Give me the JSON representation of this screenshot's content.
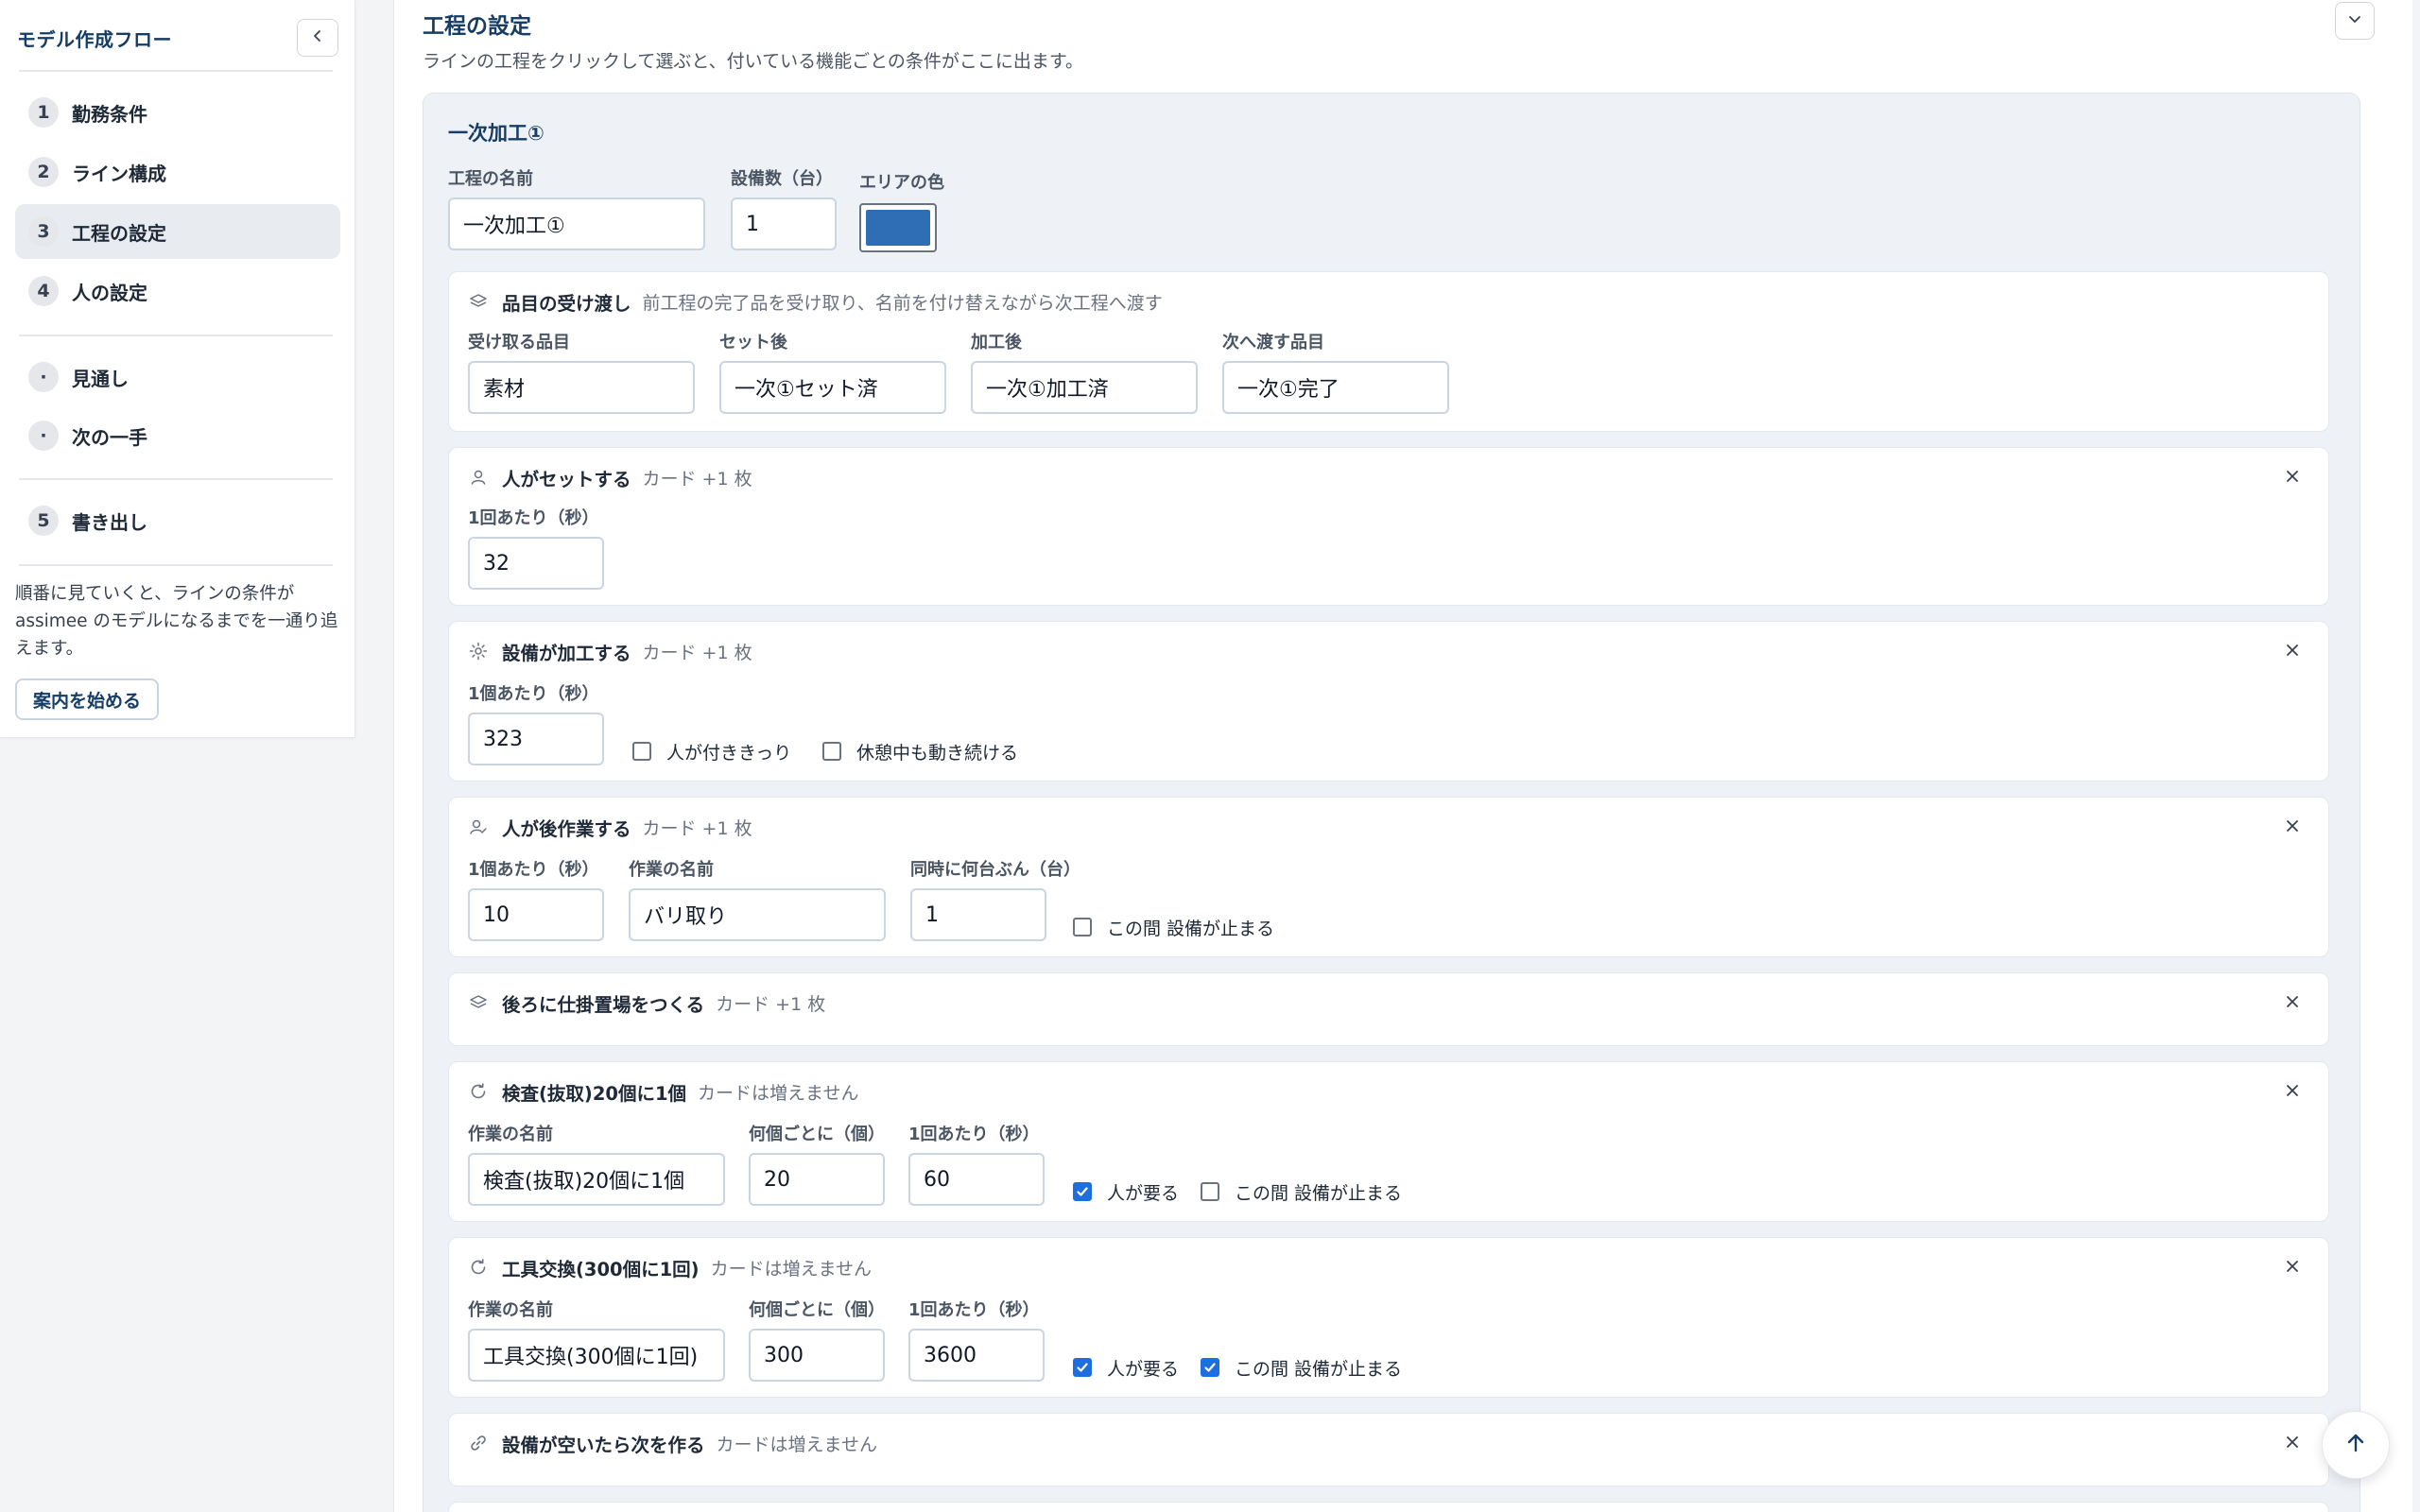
{
  "sidebar": {
    "title": "モデル作成フロー",
    "collapse_icon": "chevron-left-icon",
    "items": [
      {
        "num": "1",
        "label": "勤務条件"
      },
      {
        "num": "2",
        "label": "ライン構成"
      },
      {
        "num": "3",
        "label": "工程の設定"
      },
      {
        "num": "4",
        "label": "人の設定"
      },
      {
        "num": "·",
        "label": "見通し"
      },
      {
        "num": "·",
        "label": "次の一手"
      },
      {
        "num": "5",
        "label": "書き出し"
      }
    ],
    "active_index": 2,
    "help_line1": "順番に見ていくと、ラインの条件が",
    "help_line2": "assimee のモデルになるまでを一通り追",
    "help_line3": "えます。",
    "guide_button": "案内を始める"
  },
  "main": {
    "title": "工程の設定",
    "description": "ラインの工程をクリックして選ぶと、付いている機能ごとの条件がここに出ます。",
    "process": {
      "title": "一次加工①",
      "name_label": "工程の名前",
      "name_value": "一次加工①",
      "count_label": "設備数（台）",
      "count_value": "1",
      "color_label": "エリアの色",
      "color_value": "#2f6db5"
    },
    "cards": {
      "handoff": {
        "title": "品目の受け渡し",
        "sub": "前工程の完了品を受け取り、名前を付け替えながら次工程へ渡す",
        "fields": [
          {
            "label": "受け取る品目",
            "value": "素材"
          },
          {
            "label": "セット後",
            "value": "一次①セット済"
          },
          {
            "label": "加工後",
            "value": "一次①加工済"
          },
          {
            "label": "次へ渡す品目",
            "value": "一次①完了"
          }
        ]
      },
      "set": {
        "title": "人がセットする",
        "sub": "カード +1 枚",
        "time_label": "1回あたり（秒）",
        "time_value": "32"
      },
      "machine": {
        "title": "設備が加工する",
        "sub": "カード +1 枚",
        "time_label": "1個あたり（秒）",
        "time_value": "323",
        "check1": "人が付ききっり",
        "check1_checked": false,
        "check2": "休憩中も動き続ける",
        "check2_checked": false
      },
      "post": {
        "title": "人が後作業する",
        "sub": "カード +1 枚",
        "time_label": "1個あたり（秒）",
        "time_value": "10",
        "name_label": "作業の名前",
        "name_value": "バリ取り",
        "units_label": "同時に何台ぶん（台）",
        "units_value": "1",
        "check": "この間 設備が止まる",
        "check_checked": false
      },
      "buffer": {
        "title": "後ろに仕掛置場をつくる",
        "sub": "カード +1 枚"
      },
      "inspect": {
        "title": "検査(抜取)20個に1個",
        "sub": "カードは増えません",
        "name_label": "作業の名前",
        "name_value": "検査(抜取)20個に1個",
        "every_label": "何個ごとに（個）",
        "every_value": "20",
        "time_label": "1回あたり（秒）",
        "time_value": "60",
        "check1": "人が要る",
        "check1_checked": true,
        "check2": "この間 設備が止まる",
        "check2_checked": false
      },
      "tool": {
        "title": "工具交換(300個に1回)",
        "sub": "カードは増えません",
        "name_label": "作業の名前",
        "name_value": "工具交換(300個に1回)",
        "every_label": "何個ごとに（個）",
        "every_value": "300",
        "time_label": "1回あたり（秒）",
        "time_value": "3600",
        "check1": "人が要る",
        "check1_checked": true,
        "check2": "この間 設備が止まる",
        "check2_checked": true
      },
      "next": {
        "title": "設備が空いたら次を作る",
        "sub": "カードは増えません"
      }
    }
  },
  "scroll_top_icon": "arrow-up-icon"
}
